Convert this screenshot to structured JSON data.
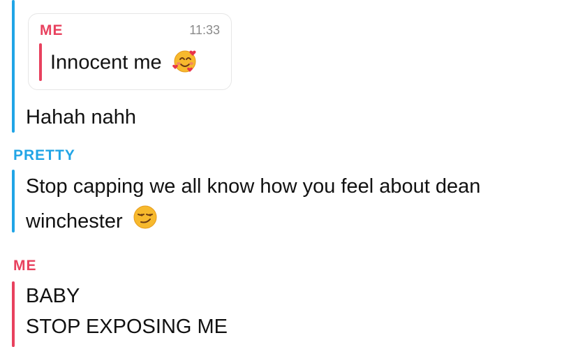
{
  "colors": {
    "me": "#e8415e",
    "pretty": "#21a5e6",
    "text": "#111111",
    "time": "#8a8a8a"
  },
  "quoted_reply": {
    "sender": "ME",
    "time": "11:33",
    "text": "Innocent me",
    "emoji_icon": "smiling-face-with-hearts-icon"
  },
  "message_reply": {
    "text": "Hahah nahh"
  },
  "pretty_block": {
    "sender": "PRETTY",
    "line1": "Stop capping we all know how you feel about dean",
    "line2": "winchester",
    "emoji_icon": "smirking-face-icon"
  },
  "me_block": {
    "sender": "ME",
    "line1": "BABY",
    "line2": "STOP EXPOSING ME"
  }
}
